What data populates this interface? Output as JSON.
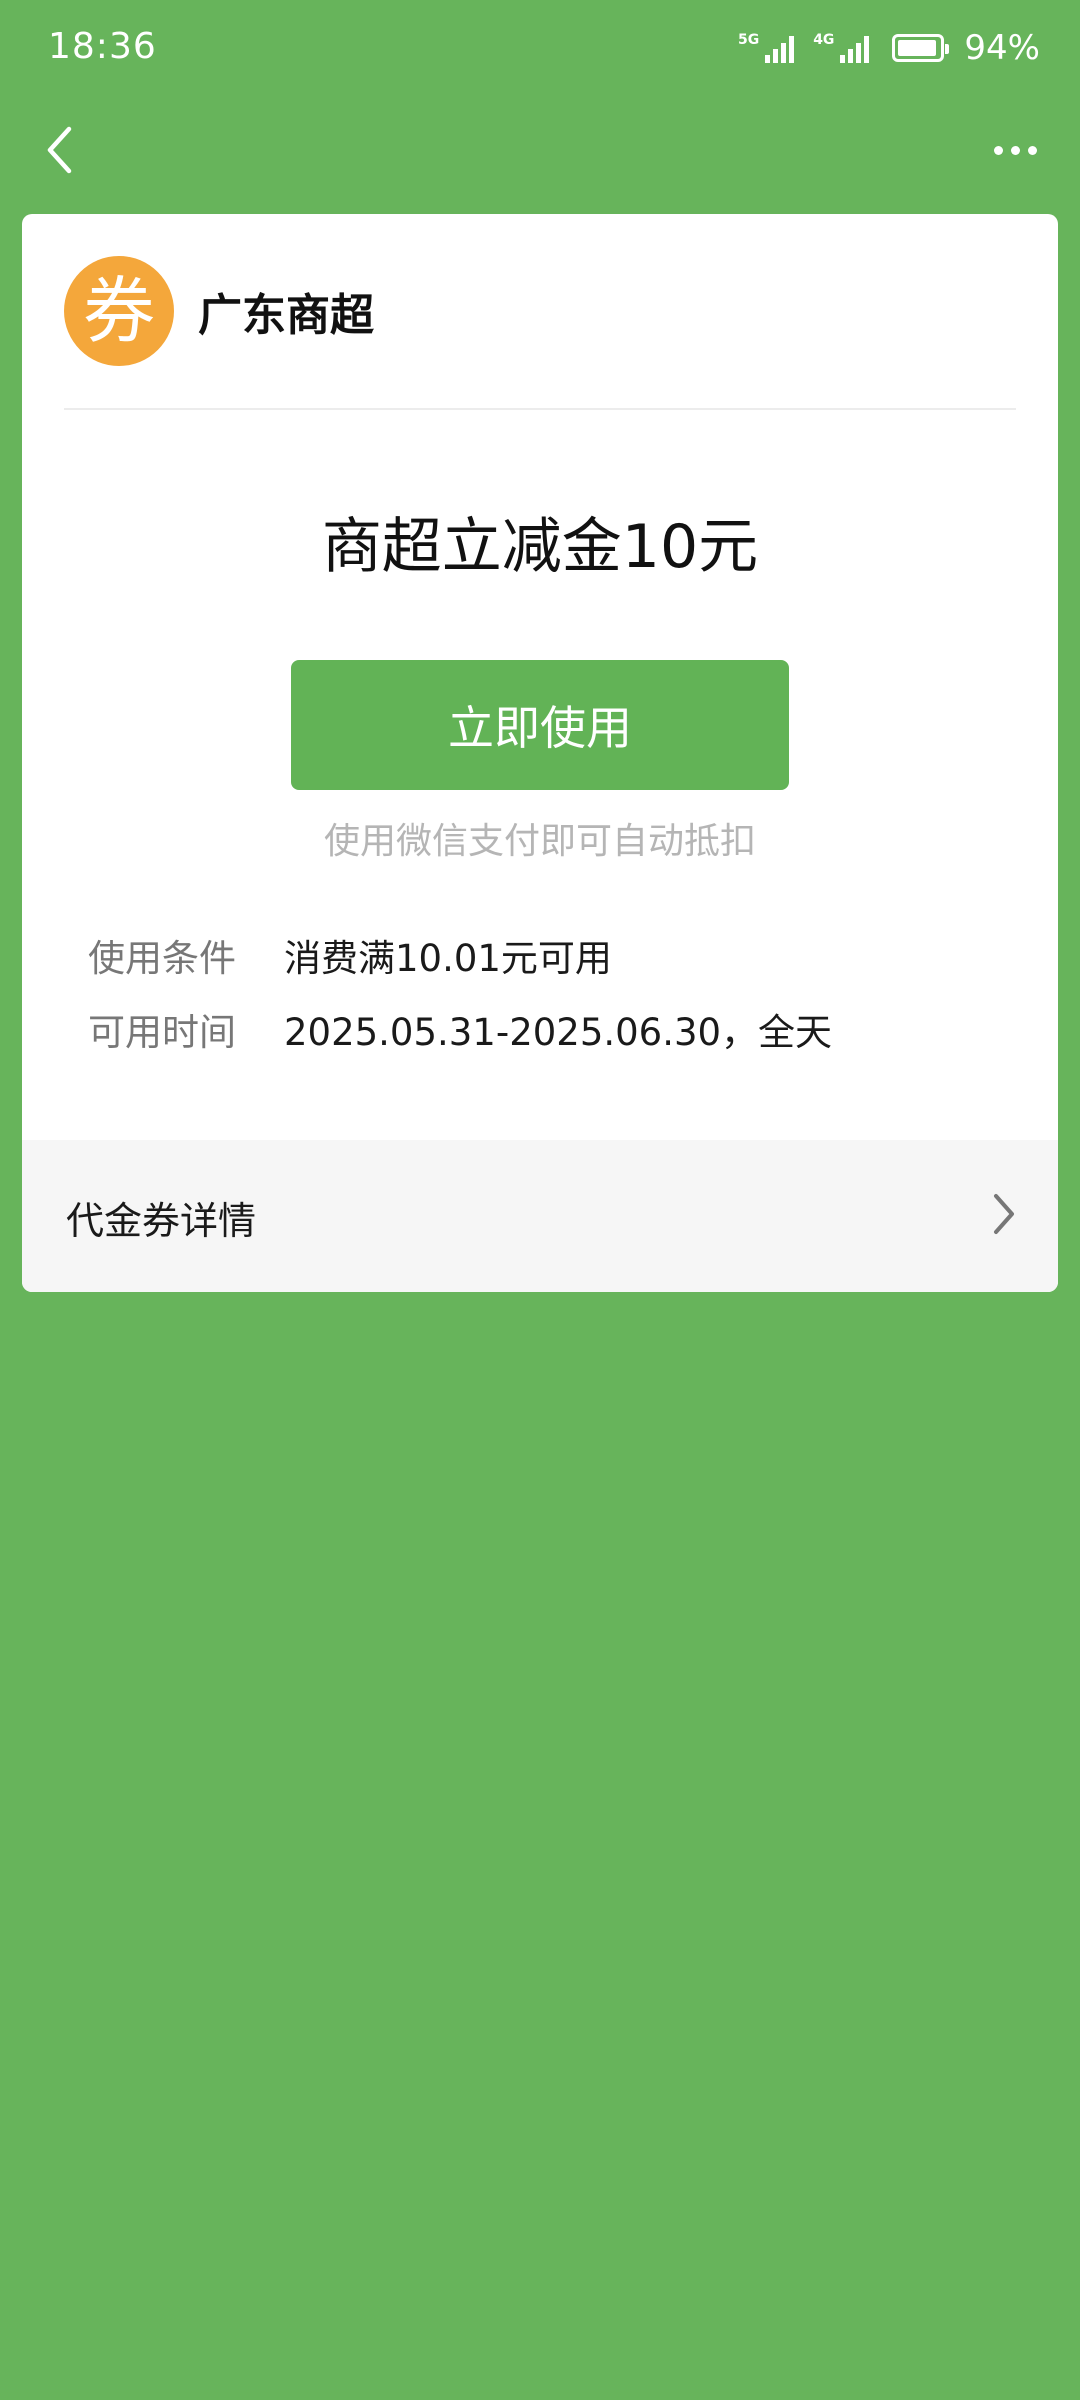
{
  "status_bar": {
    "time": "18:36",
    "network_1": "5G",
    "network_2": "4G",
    "battery_percent": 94,
    "battery_text": "94%"
  },
  "nav": {
    "back_icon": "chevron-left-icon",
    "more_icon": "more-horizontal-icon"
  },
  "coupon": {
    "logo_char": "券",
    "merchant_name": "广东商超",
    "title": "商超立减金10元",
    "use_button_label": "立即使用",
    "hint": "使用微信支付即可自动抵扣",
    "condition_label": "使用条件",
    "condition_value": "消费满10.01元可用",
    "time_label": "可用时间",
    "time_value": "2025.05.31-2025.06.30，全天",
    "details_label": "代金券详情"
  },
  "colors": {
    "background": "#67b45b",
    "button": "#62b356",
    "logo": "#f4a73b"
  }
}
